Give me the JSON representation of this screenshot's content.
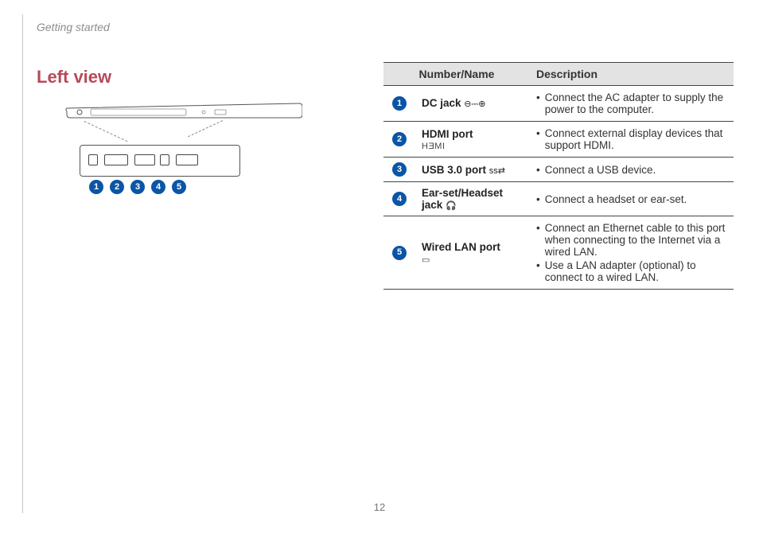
{
  "chapter": "Getting started",
  "section_title": "Left view",
  "page_number": "12",
  "table": {
    "headers": {
      "name": "Number/Name",
      "desc": "Description"
    },
    "rows": [
      {
        "num": "1",
        "name": "DC jack",
        "icon_text": "⊖⎓⊕",
        "desc": [
          "Connect the AC adapter to supply the power to the computer."
        ]
      },
      {
        "num": "2",
        "name": "HDMI port",
        "icon_text": "HƎMI",
        "icon_below": true,
        "desc": [
          "Connect external display devices that support HDMI."
        ]
      },
      {
        "num": "3",
        "name": "USB 3.0 port",
        "icon_text": "ss⇄",
        "desc": [
          "Connect a USB device."
        ]
      },
      {
        "num": "4",
        "name": "Ear-set/Headset jack",
        "icon_text": "🎧",
        "desc": [
          "Connect a headset or ear-set."
        ]
      },
      {
        "num": "5",
        "name": "Wired LAN port",
        "icon_text": "▭",
        "icon_below": true,
        "desc": [
          "Connect an Ethernet cable to this port when connecting to the Internet via a wired LAN.",
          "Use a LAN adapter (optional) to connect to a wired LAN."
        ]
      }
    ]
  },
  "diagram": {
    "markers": [
      "1",
      "2",
      "3",
      "4",
      "5"
    ]
  }
}
